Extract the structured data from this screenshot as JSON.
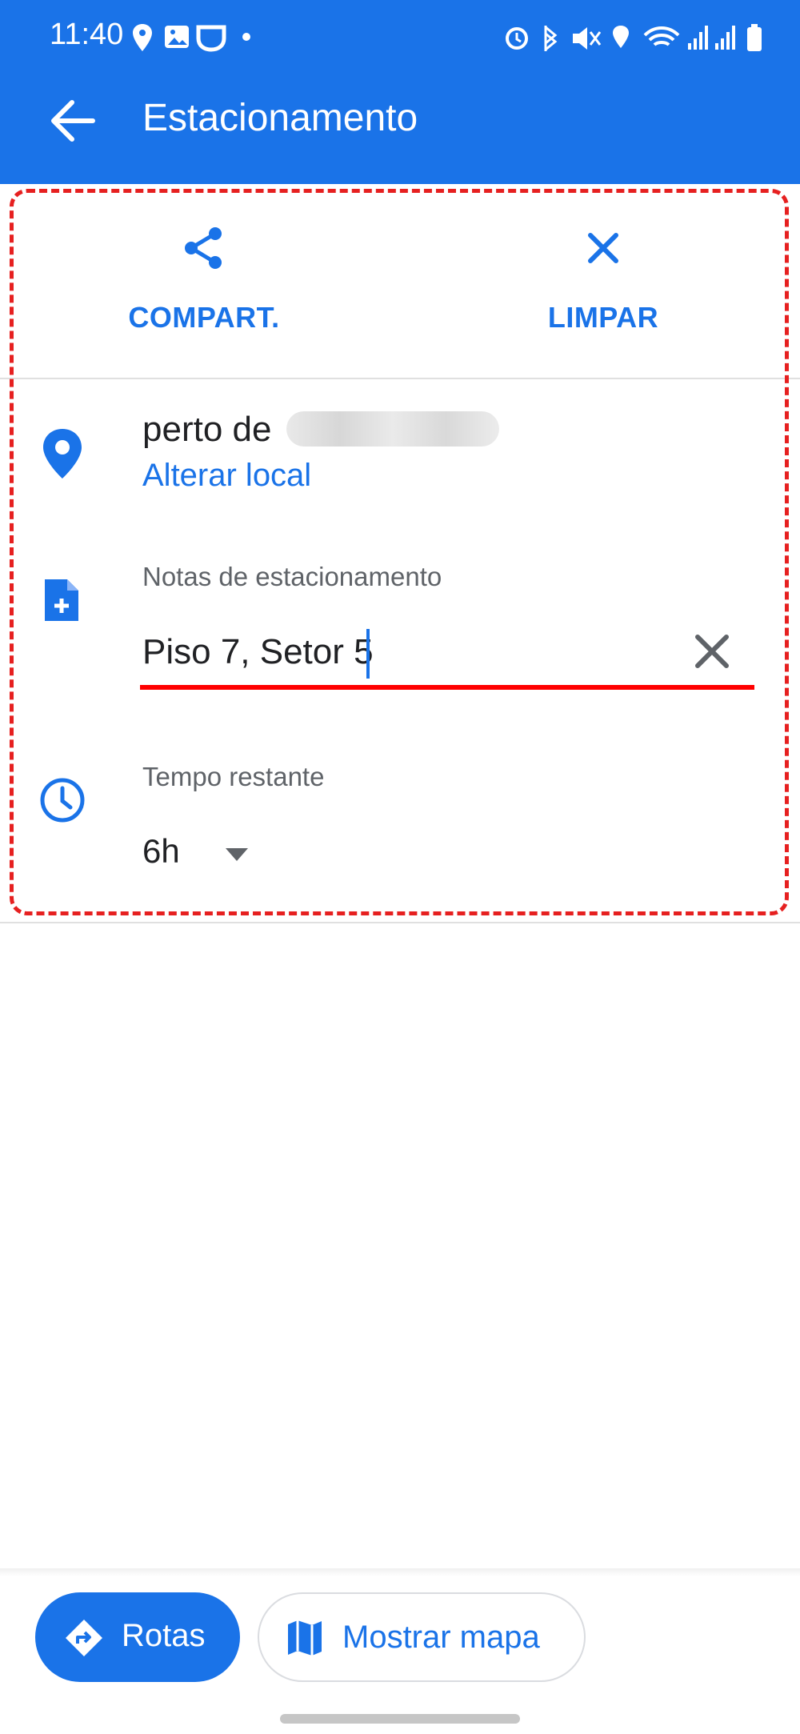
{
  "status_bar": {
    "time": "11:40"
  },
  "app_bar": {
    "title": "Estacionamento"
  },
  "actions": {
    "share_label": "COMPART.",
    "clear_label": "LIMPAR"
  },
  "location": {
    "text": "perto de ",
    "change_link": "Alterar local"
  },
  "notes": {
    "label": "Notas de estacionamento",
    "value": "Piso 7, Setor 5"
  },
  "time": {
    "label": "Tempo restante",
    "value": "6h"
  },
  "bottom": {
    "routes_label": "Rotas",
    "map_label": "Mostrar mapa"
  },
  "colors": {
    "brand": "#1a73e8",
    "highlight": "#e62020",
    "underline": "#ff0000"
  }
}
